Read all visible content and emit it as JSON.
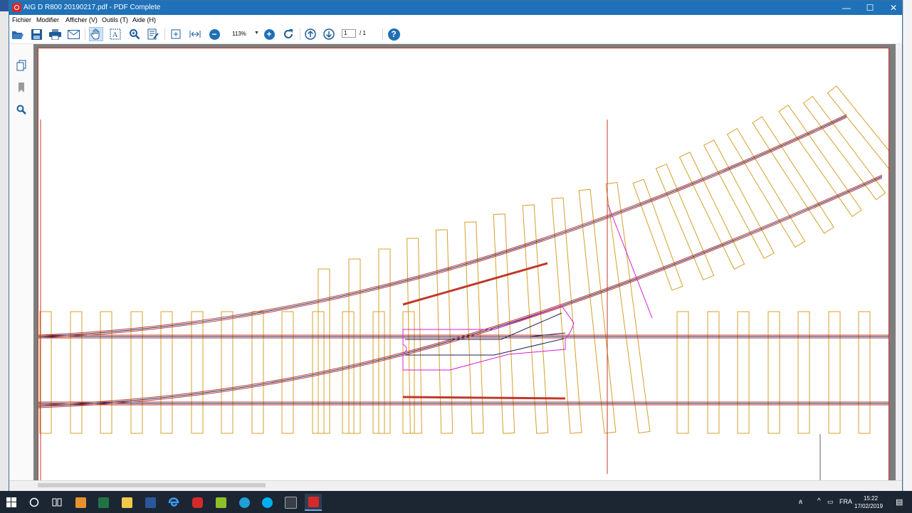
{
  "window": {
    "title": "AIG D R800 20190217.pdf - PDF Complete",
    "controls": [
      "—",
      "☐",
      "✕"
    ]
  },
  "menu": [
    "Fichier",
    "Modifier",
    "Afficher (V)",
    "Outils (T)",
    "Aide (H)"
  ],
  "toolbar": {
    "buttons": [
      {
        "name": "open",
        "icon": "folder-open-icon"
      },
      {
        "name": "save",
        "icon": "floppy-disk-icon"
      },
      {
        "name": "print",
        "icon": "printer-icon"
      },
      {
        "name": "email",
        "icon": "envelope-icon"
      },
      {
        "name": "hand-tool",
        "icon": "hand-icon",
        "active": true
      },
      {
        "name": "select-text",
        "icon": "text-select-icon"
      },
      {
        "name": "zoom-tool",
        "icon": "magnifier-icon"
      },
      {
        "name": "annotate",
        "icon": "pencil-note-icon"
      },
      {
        "name": "fit-page",
        "icon": "fit-page-icon"
      },
      {
        "name": "fit-width",
        "icon": "fit-width-icon"
      },
      {
        "name": "zoom-out",
        "icon": "minus-icon"
      },
      {
        "name": "zoom-in",
        "icon": "plus-icon"
      },
      {
        "name": "rotate",
        "icon": "rotate-icon"
      },
      {
        "name": "prev-page",
        "icon": "arrow-up-icon"
      },
      {
        "name": "next-page",
        "icon": "arrow-down-icon"
      },
      {
        "name": "help",
        "icon": "help-icon"
      }
    ],
    "zoom": "113%",
    "page": {
      "current": "1",
      "total": "/ 1"
    }
  },
  "sidebar": [
    "pages-icon",
    "bookmark-icon",
    "search-icon"
  ],
  "taskbar": {
    "apps": [
      "start-icon",
      "cortana-icon",
      "task-view-icon",
      "media-player-icon",
      "excel-icon",
      "file-explorer-icon",
      "word-icon",
      "edge-icon",
      "pdf-complete-icon",
      "app-green-icon",
      "app-cyan-icon",
      "skype-icon",
      "display-icon",
      "pdf-active-icon"
    ],
    "language": "FRA",
    "time": "15:22",
    "date": "17/02/2019"
  },
  "colors": {
    "titlebar": "#1f72b8",
    "accent": "#1f6fb5",
    "rail": "#c0392b",
    "sleeper": "#d4a02a",
    "track_center": "#1b1f5e",
    "frog": "#d61ed6"
  }
}
